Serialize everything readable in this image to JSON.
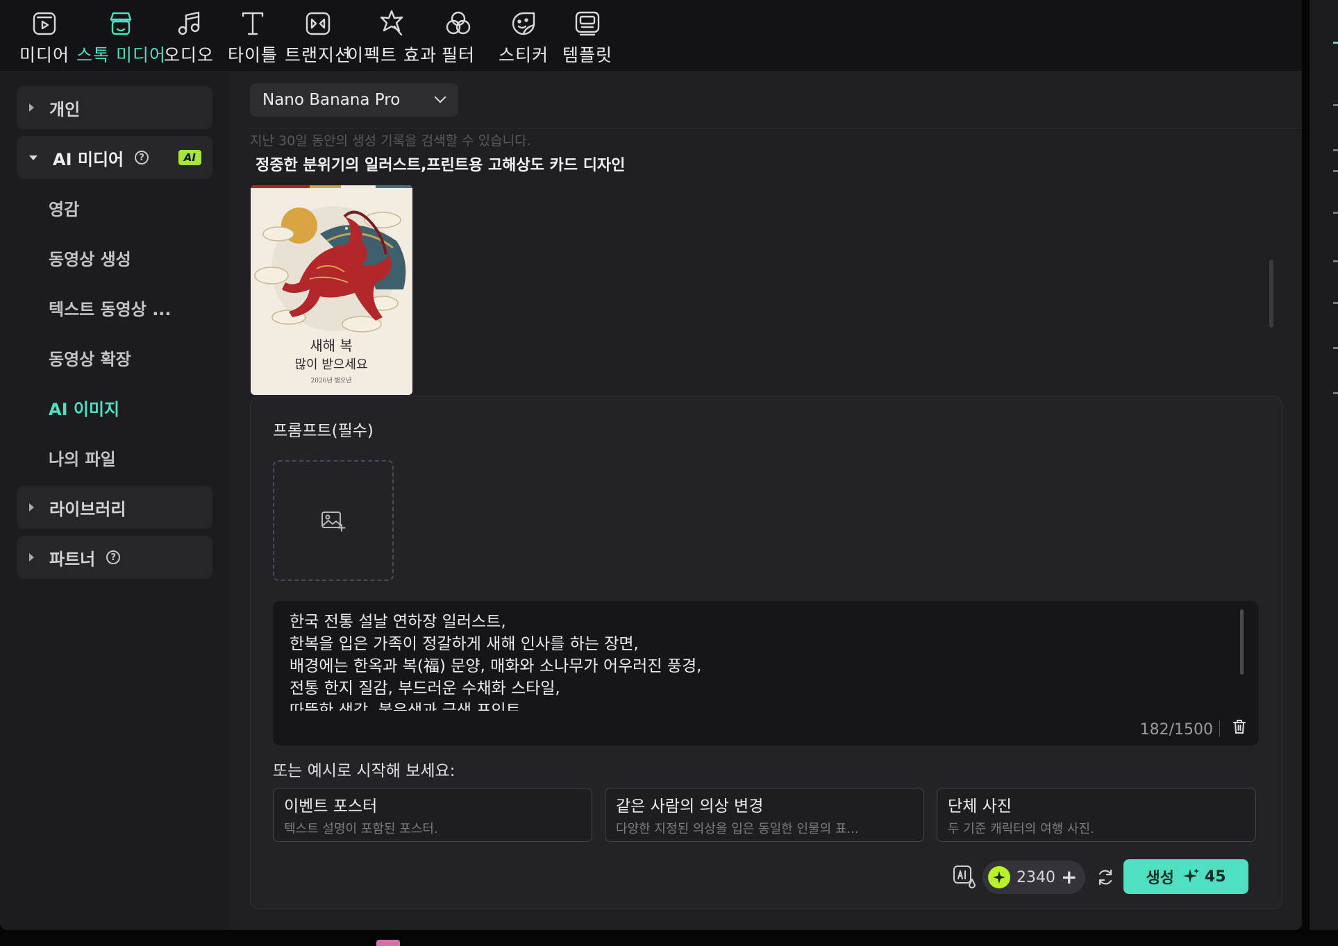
{
  "toolbar": {
    "items": [
      {
        "label": "미디어",
        "icon": "media-icon"
      },
      {
        "label": "스톡 미디어",
        "icon": "stock-media-icon"
      },
      {
        "label": "오디오",
        "icon": "audio-icon"
      },
      {
        "label": "타이틀",
        "icon": "title-icon"
      },
      {
        "label": "트랜지션",
        "icon": "transition-icon"
      },
      {
        "label": "이펙트 효과",
        "icon": "effect-icon"
      },
      {
        "label": "필터",
        "icon": "filter-icon"
      },
      {
        "label": "스티커",
        "icon": "sticker-icon"
      },
      {
        "label": "템플릿",
        "icon": "template-icon"
      }
    ],
    "active": "스톡 미디어"
  },
  "sidebar": {
    "personal": "개인",
    "ai_media": "AI 미디어",
    "ai_badge": "AI",
    "help_glyph": "?",
    "sub_items": [
      "영감",
      "동영상 생성",
      "텍스트 동영상 ...",
      "동영상 확장",
      "AI 이미지",
      "나의 파일"
    ],
    "active_sub": "AI 이미지",
    "library": "라이브러리",
    "partner": "파트너"
  },
  "main": {
    "model": "Nano Banana Pro",
    "history_hint": "지난 30일 동안의 생성 기록을 검색할 수 있습니다.",
    "generation_title": "정중한 분위기의 일러스트,프린트용 고해상도 카드 디자인",
    "thumbnail": {
      "line1": "새해 복",
      "line2": "많이 받으세요",
      "line3": "2026년 병오년"
    }
  },
  "prompt_panel": {
    "label": "프롬프트(필수)",
    "prompt_text": "한국 전통 설날 연하장 일러스트,\n한복을 입은 가족이 정갈하게 새해 인사를 하는 장면,\n배경에는 한옥과 복(福) 문양, 매화와 소나무가 어우러진 풍경,\n전통 한지 질감, 부드러운 수채화 스타일,\n따뜻한 색감, 붉은색과 금색 포인트,",
    "counter": "182/1500",
    "examples_label": "또는 예시로 시작해 보세요:",
    "examples": [
      {
        "title": "이벤트 포스터",
        "subtitle": "텍스트 설명이 포함된 포스터."
      },
      {
        "title": "같은 사람의 의상 변경",
        "subtitle": "다양한 지정된 의상을 입은 동일한 인물의 표..."
      },
      {
        "title": "단체 사진",
        "subtitle": "두 기준 캐릭터의 여행 사진."
      }
    ],
    "credits": "2340",
    "credits_plus": "+",
    "generate_label": "생성",
    "generate_cost": "45"
  },
  "colors": {
    "accent": "#4fe0c2",
    "ai_badge": "#a6e63c",
    "coin": "#b9f22c",
    "background": "#1f1f22"
  }
}
